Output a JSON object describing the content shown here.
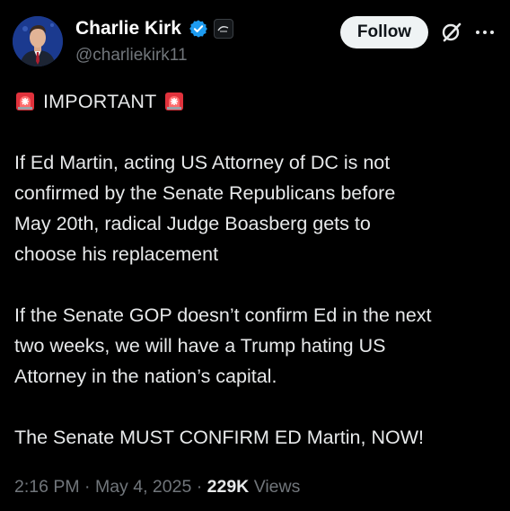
{
  "author": {
    "name": "Charlie Kirk",
    "handle": "@charliekirk11"
  },
  "actions": {
    "follow_label": "Follow"
  },
  "tweet": {
    "headline": "IMPORTANT",
    "paragraph1": [
      "If Ed Martin, acting US Attorney of DC is not",
      "confirmed by the Senate Republicans before",
      "May 20th, radical Judge Boasberg gets to",
      "choose his replacement"
    ],
    "paragraph2": [
      "If the Senate GOP doesn’t confirm Ed in the next",
      "two weeks, we will have a Trump hating US",
      "Attorney in the nation’s capital."
    ],
    "paragraph3": [
      "The Senate MUST CONFIRM ED Martin, NOW!"
    ]
  },
  "meta": {
    "time": "2:16 PM",
    "separator": "·",
    "date": "May 4, 2025",
    "views_count": "229K",
    "views_label": "Views"
  },
  "icons": {
    "verified": "verified-badge-icon",
    "affiliate": "affiliate-badge-icon",
    "grok": "grok-icon",
    "more": "more-icon",
    "siren": "police-light-emoji"
  },
  "colors": {
    "background": "#000000",
    "text_primary": "#e7e9ea",
    "text_secondary": "#71767b",
    "verified_blue": "#1d9bf0",
    "follow_bg": "#eff3f4",
    "follow_text": "#0f1419"
  }
}
